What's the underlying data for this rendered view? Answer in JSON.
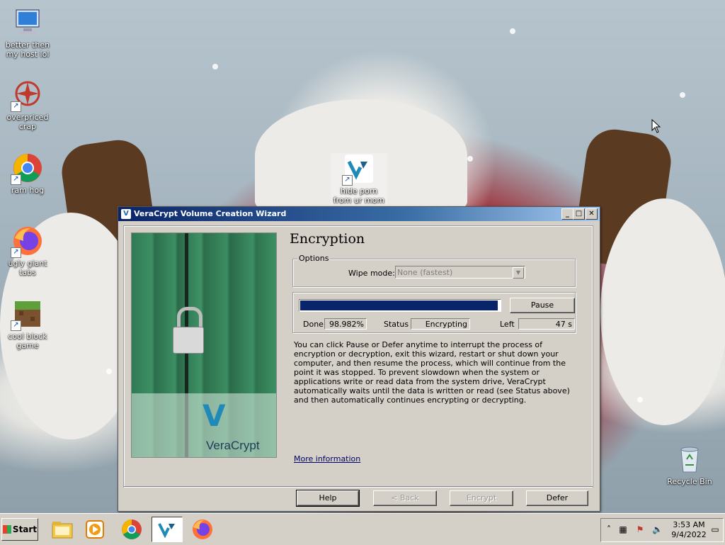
{
  "desktop": {
    "icons": [
      {
        "label": "better then my host lol",
        "icon": "computer-icon"
      },
      {
        "label": "overpriced crap",
        "icon": "app-shortcut-icon"
      },
      {
        "label": "ram hog",
        "icon": "chrome-icon"
      },
      {
        "label": "ugly giant tabs",
        "icon": "firefox-icon"
      },
      {
        "label": "cool block game",
        "icon": "minecraft-icon"
      },
      {
        "label": "hide porn from ur mom",
        "icon": "veracrypt-icon"
      },
      {
        "label": "Recycle Bin",
        "icon": "recycle-bin-icon"
      }
    ]
  },
  "window": {
    "title": "VeraCrypt Volume Creation Wizard",
    "logo_text": "VeraCrypt",
    "heading": "Encryption",
    "options_legend": "Options",
    "wipe_mode_label": "Wipe mode:",
    "wipe_mode_value": "None (fastest)",
    "progress_fraction": 0.98982,
    "pause_label": "Pause",
    "done_label": "Done",
    "done_value": "98.982%",
    "status_label": "Status",
    "status_value": "Encrypting",
    "left_label": "Left",
    "left_value": "47 s",
    "info_text": "You can click Pause or Defer anytime to interrupt the process of encryption or decryption, exit this wizard, restart or shut down your computer, and then resume the process, which will continue from the point it was stopped. To prevent slowdown when the system or applications write or read data from the system drive, VeraCrypt automatically waits until the data is written or read (see Status above) and then automatically continues encrypting or decrypting.",
    "more_info": "More information",
    "buttons": {
      "help": "Help",
      "back": "< Back",
      "encrypt": "Encrypt",
      "defer": "Defer"
    }
  },
  "taskbar": {
    "start_label": "Start",
    "apps": [
      "file-explorer-icon",
      "media-player-icon",
      "chrome-icon",
      "veracrypt-icon",
      "firefox-icon"
    ],
    "clock_time": "3:53 AM",
    "clock_date": "9/4/2022"
  },
  "colors": {
    "titlebar": "#0a246a",
    "progress": "#0a246a",
    "face": "#d4d0c8"
  }
}
